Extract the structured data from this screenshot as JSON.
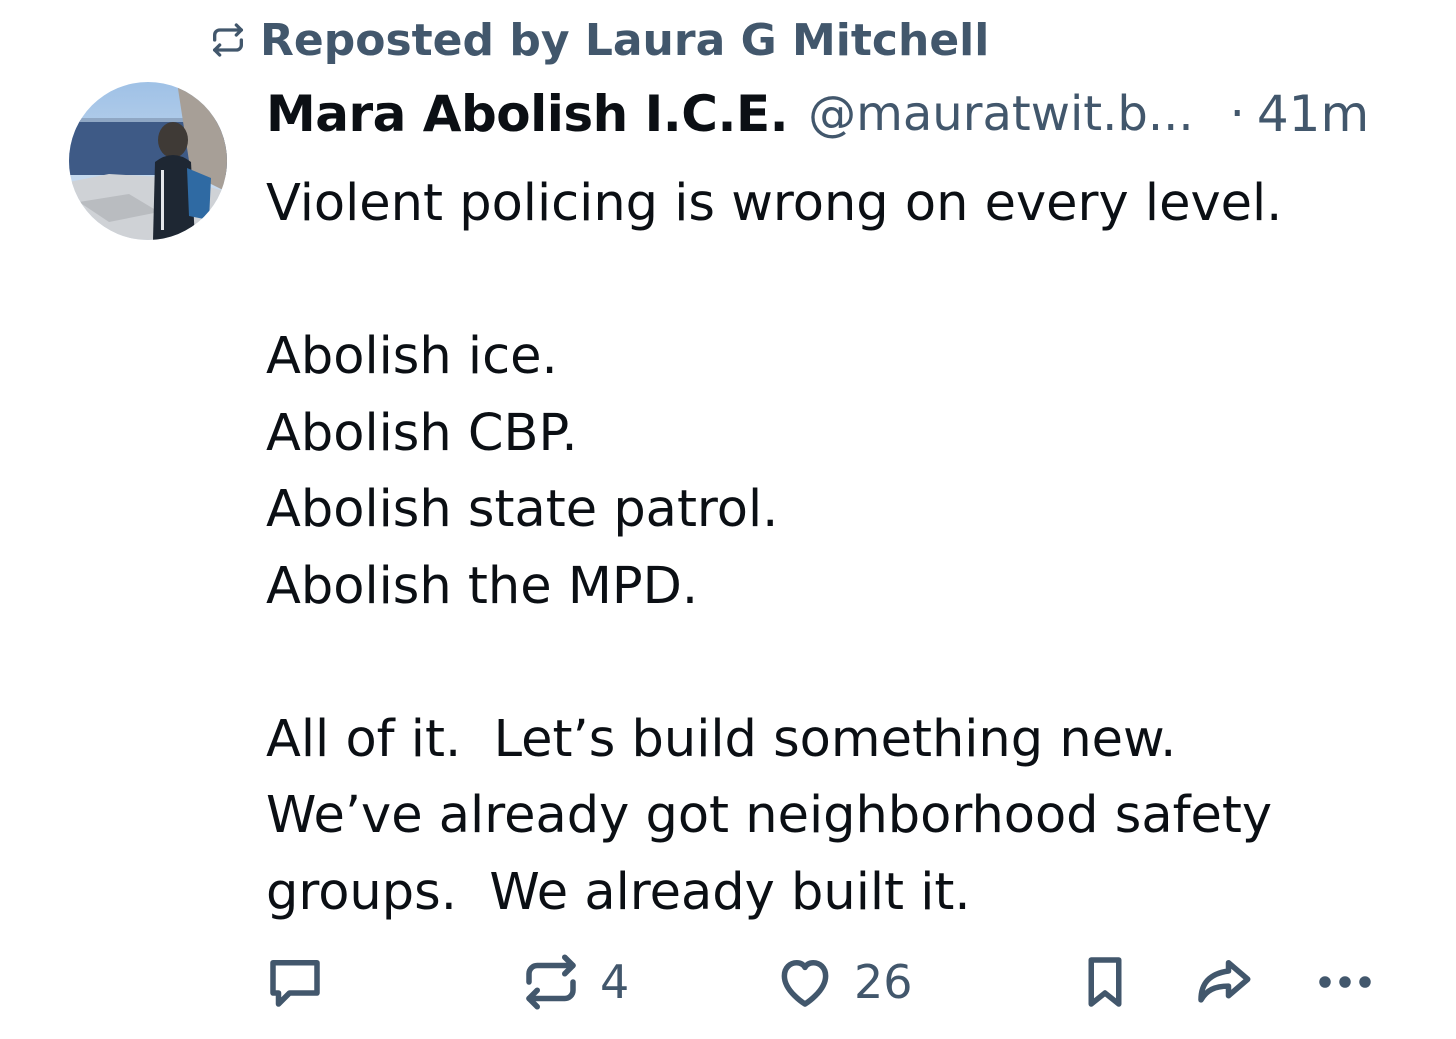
{
  "repost": {
    "icon": "repost-icon",
    "text": "Reposted by Laura G Mitchell"
  },
  "author": {
    "avatar": "avatar",
    "display_name": "Mara Abolish I.C.E.",
    "handle": "@mauratwit.b...",
    "separator": "·",
    "time": "41m"
  },
  "post": {
    "lines": [
      "Violent policing is wrong on every level.",
      "",
      "Abolish ice.",
      "Abolish CBP.",
      "Abolish state patrol.",
      "Abolish the MPD.",
      "",
      "All of it.  Let’s build something new.",
      "We’ve already got neighborhood safety",
      "groups.  We already built it."
    ]
  },
  "actions": {
    "reply": {
      "icon": "reply-icon"
    },
    "repost": {
      "icon": "repost-icon",
      "count": "4"
    },
    "like": {
      "icon": "heart-icon",
      "count": "26"
    },
    "bookmark": {
      "icon": "bookmark-icon"
    },
    "share": {
      "icon": "share-icon"
    },
    "more": {
      "icon": "more-icon"
    }
  },
  "colors": {
    "text": "#0b0f14",
    "muted": "#42576c",
    "background": "#ffffff"
  }
}
